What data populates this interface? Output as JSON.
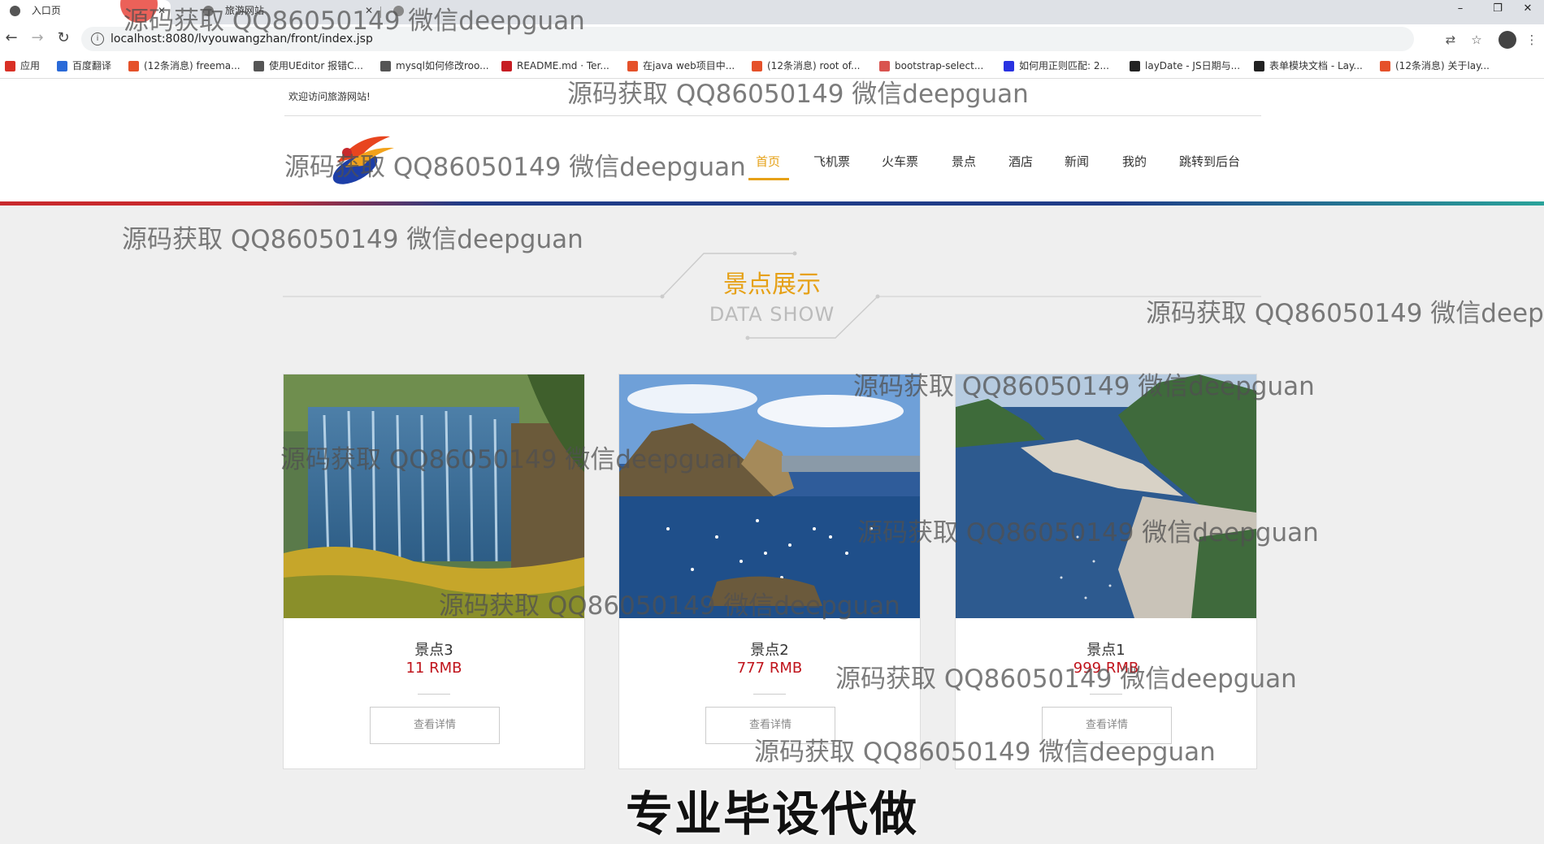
{
  "browser": {
    "tabs": [
      {
        "title": "入口页",
        "active": true
      },
      {
        "title": "旅游网站",
        "active": false
      },
      {
        "title": "",
        "active": false
      }
    ],
    "url": "localhost:8080/lvyouwangzhan/front/index.jsp",
    "window_controls": {
      "minimize": "–",
      "restore": "❐",
      "close": "✕"
    },
    "bookmarks": [
      {
        "label": "应用",
        "icon": "apps-icon",
        "color": "#d93025"
      },
      {
        "label": "百度翻译",
        "icon": "translate-icon",
        "color": "#2a6ad8"
      },
      {
        "label": "(12条消息) freema...",
        "icon": "csdn-icon",
        "color": "#e5512a"
      },
      {
        "label": "使用UEditor 报错C...",
        "icon": "ue-icon",
        "color": "#555555"
      },
      {
        "label": "mysql如何修改roo...",
        "icon": "ue-icon",
        "color": "#555555"
      },
      {
        "label": "README.md · Ter...",
        "icon": "gitee-icon",
        "color": "#c71d23"
      },
      {
        "label": "在java web项目中...",
        "icon": "csdn-icon",
        "color": "#e5512a"
      },
      {
        "label": "(12条消息) root of...",
        "icon": "csdn-icon",
        "color": "#e5512a"
      },
      {
        "label": "bootstrap-select...",
        "icon": "site-icon",
        "color": "#d9534f"
      },
      {
        "label": "如何用正则匹配: 2...",
        "icon": "baidu-icon",
        "color": "#2932e1"
      },
      {
        "label": "layDate - JS日期与...",
        "icon": "layui-icon",
        "color": "#222222"
      },
      {
        "label": "表单模块文档 - Lay...",
        "icon": "layui-icon",
        "color": "#222222"
      },
      {
        "label": "(12条消息) 关于lay...",
        "icon": "csdn-icon",
        "color": "#e5512a"
      }
    ]
  },
  "site": {
    "welcome": "欢迎访问旅游网站!",
    "nav": [
      {
        "label": "首页",
        "active": true
      },
      {
        "label": "飞机票",
        "active": false
      },
      {
        "label": "火车票",
        "active": false
      },
      {
        "label": "景点",
        "active": false
      },
      {
        "label": "酒店",
        "active": false
      },
      {
        "label": "新闻",
        "active": false
      },
      {
        "label": "我的",
        "active": false
      },
      {
        "label": "跳转到后台",
        "active": false
      }
    ],
    "section": {
      "title": "景点展示",
      "subtitle": "DATA SHOW"
    },
    "cards": [
      {
        "name": "景点3",
        "price": "11 RMB",
        "button": "查看详情"
      },
      {
        "name": "景点2",
        "price": "777 RMB",
        "button": "查看详情"
      },
      {
        "name": "景点1",
        "price": "999 RMB",
        "button": "查看详情"
      }
    ],
    "accent_color": "#e6a117",
    "price_color": "#c0141c"
  },
  "overlay": {
    "watermark": "源码获取 QQ86050149 微信deepguan",
    "watermark_short": "源码获取 QQ86050149 微信deepgu",
    "banner": "专业毕设代做"
  }
}
